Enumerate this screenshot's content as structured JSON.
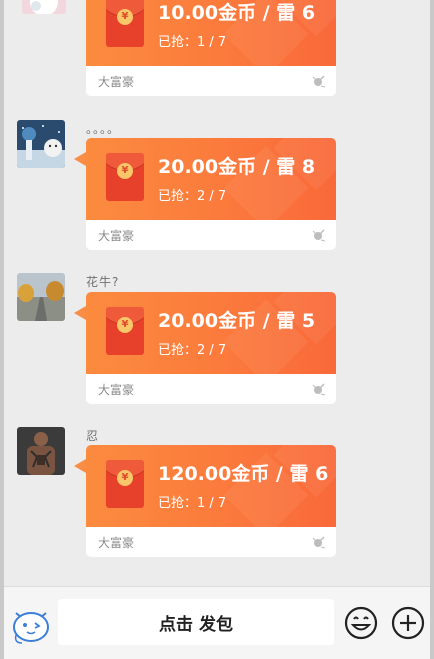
{
  "messages": [
    {
      "nick": "",
      "amount": "10.00金币 / 雷 6",
      "grabbed": "已抢：1 / 7",
      "brand": "大富豪",
      "avatar": "avatar-pink-cat"
    },
    {
      "nick": "。。。。",
      "amount": "20.00金币 / 雷 8",
      "grabbed": "已抢：2 / 7",
      "brand": "大富豪",
      "avatar": "avatar-girl-snow"
    },
    {
      "nick": "花牛?",
      "amount": "20.00金币 / 雷 5",
      "grabbed": "已抢：2 / 7",
      "brand": "大富豪",
      "avatar": "avatar-road-trees"
    },
    {
      "nick": "忍",
      "amount": "120.00金币 / 雷 6",
      "grabbed": "已抢：1 / 7",
      "brand": "大富豪",
      "avatar": "avatar-tattoo-man"
    }
  ],
  "input_bar": {
    "send_label": "点击 发包",
    "left_icon": "mascot-icon",
    "emoji_icon": "emoji-icon",
    "plus_icon": "plus-icon"
  },
  "colors": {
    "packet_gradient_start": "#fb8b3f",
    "packet_gradient_end": "#f9693a",
    "envelope": "#e8412b",
    "coin": "#f7c769",
    "mascot": "#3d7ed8"
  }
}
